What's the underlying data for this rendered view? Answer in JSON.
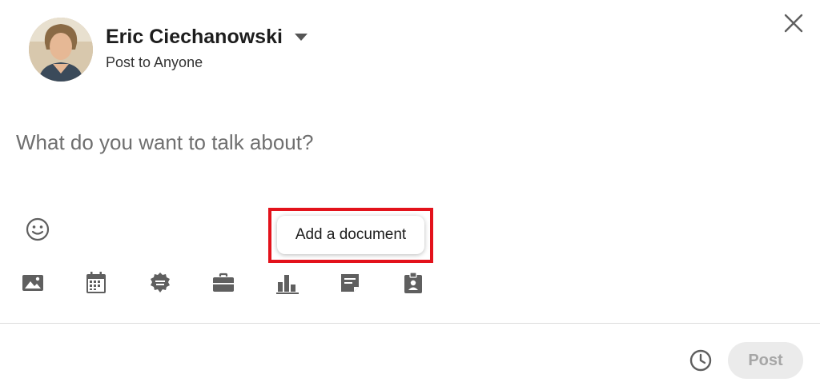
{
  "author": {
    "name": "Eric Ciechanowski",
    "post_target": "Post to Anyone"
  },
  "editor": {
    "placeholder": "What do you want to talk about?"
  },
  "tooltip": {
    "text": "Add a document"
  },
  "toolbar": {
    "tools": [
      {
        "icon": "image-icon"
      },
      {
        "icon": "calendar-icon"
      },
      {
        "icon": "celebrate-badge-icon"
      },
      {
        "icon": "briefcase-icon"
      },
      {
        "icon": "poll-chart-icon"
      },
      {
        "icon": "document-icon"
      },
      {
        "icon": "id-badge-icon"
      }
    ]
  },
  "footer": {
    "post_label": "Post"
  },
  "colors": {
    "highlight": "#e3121b",
    "icon": "#5f5f5f",
    "post_disabled_bg": "#ebebeb",
    "post_disabled_text": "#a6a6a6"
  }
}
